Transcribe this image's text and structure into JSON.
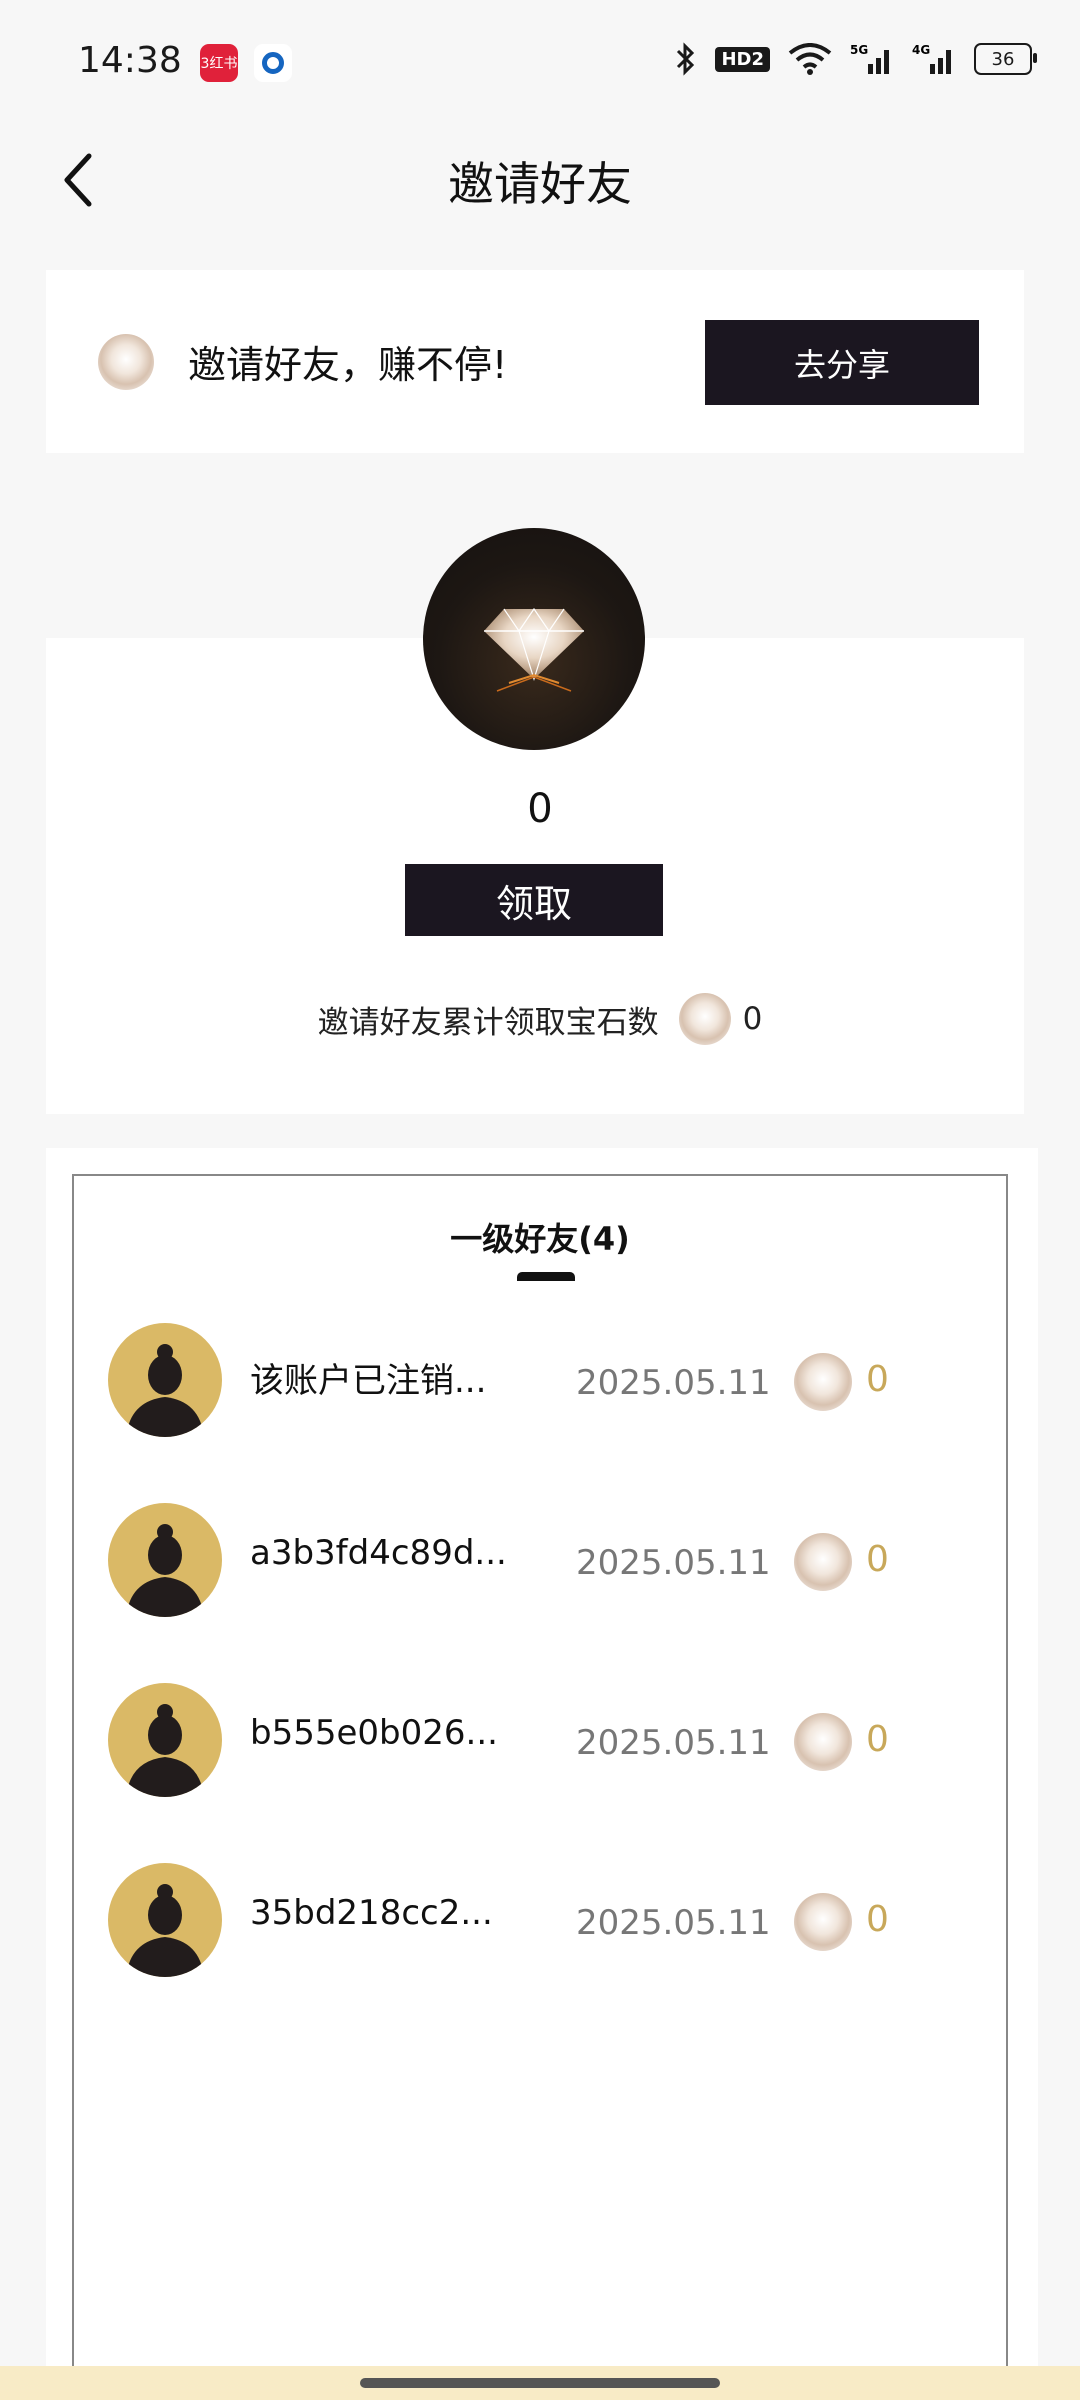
{
  "status_bar": {
    "time": "14:38",
    "notification_app_label": "3红书",
    "network_1": "5G",
    "network_2": "4G",
    "hd_label": "HD2",
    "battery": "36"
  },
  "header": {
    "title": "邀请好友"
  },
  "invite_banner": {
    "text": "邀请好友，赚不停!",
    "share_label": "去分享"
  },
  "gem_summary": {
    "count": "0",
    "claim_label": "领取",
    "total_label": "邀请好友累计领取宝石数",
    "total_value": "0"
  },
  "friends": {
    "tab_label": "一级好友(4)",
    "items": [
      {
        "name": "该账户已注销...",
        "date": "2025.05.11",
        "gems": "0"
      },
      {
        "name": "a3b3fd4c89d...",
        "date": "2025.05.11",
        "gems": "0"
      },
      {
        "name": "b555e0b026...",
        "date": "2025.05.11",
        "gems": "0"
      },
      {
        "name": "35bd218cc2...",
        "date": "2025.05.11",
        "gems": "0"
      }
    ]
  },
  "icons": {
    "back": "chevron-left-icon",
    "gem": "diamond-icon",
    "avatar": "person-silhouette-icon"
  },
  "colors": {
    "button_bg": "#1b1620",
    "gem_count_gold": "#c8a85a",
    "avatar_bg": "#dab966"
  }
}
